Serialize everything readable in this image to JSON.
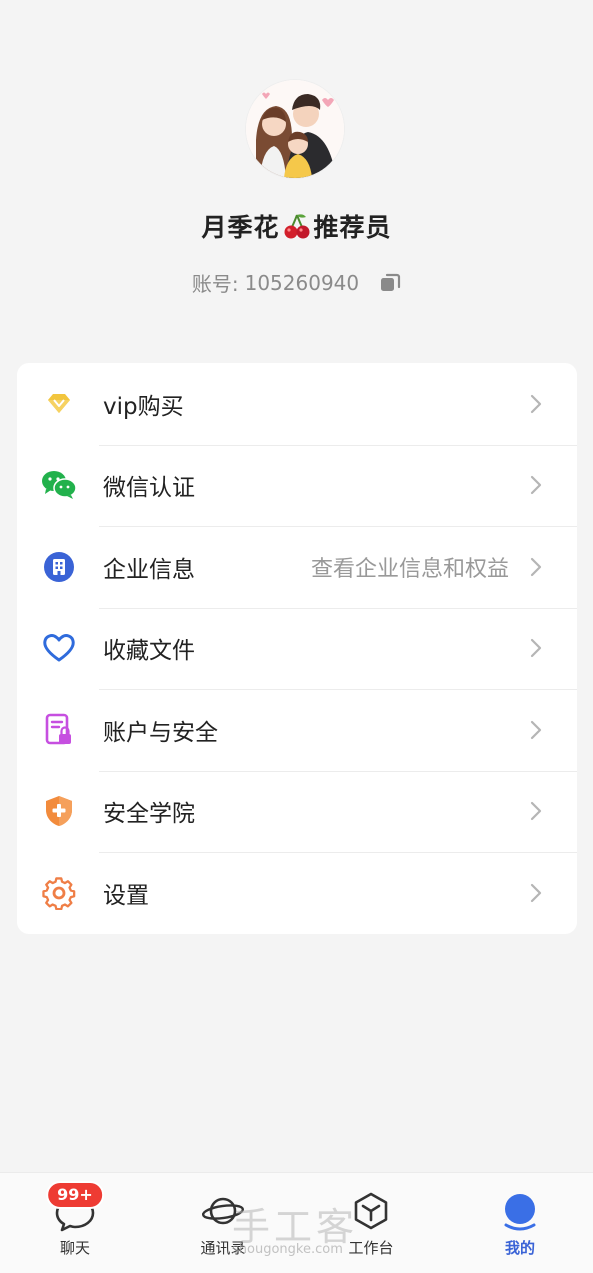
{
  "profile": {
    "name": "月季花",
    "name_suffix": "推荐员",
    "account_label": "账号:",
    "account_number": "105260940"
  },
  "menu": [
    {
      "label": "vip购买",
      "hint": "",
      "icon": "diamond-icon",
      "color": "#f2c53d"
    },
    {
      "label": "微信认证",
      "hint": "",
      "icon": "wechat-icon",
      "color": "#22b14c"
    },
    {
      "label": "企业信息",
      "hint": "查看企业信息和权益",
      "icon": "building-icon",
      "color": "#3a63d6"
    },
    {
      "label": "收藏文件",
      "hint": "",
      "icon": "heart-icon",
      "color": "#2f6bdc"
    },
    {
      "label": "账户与安全",
      "hint": "",
      "icon": "account-security-icon",
      "color": "#c64fe0"
    },
    {
      "label": "安全学院",
      "hint": "",
      "icon": "shield-icon",
      "color": "#f28b3c"
    },
    {
      "label": "设置",
      "hint": "",
      "icon": "gear-icon",
      "color": "#ef7e46"
    }
  ],
  "tabbar": {
    "tabs": [
      {
        "label": "聊天",
        "icon": "chat-icon",
        "badge": "99+"
      },
      {
        "label": "通讯录",
        "icon": "planet-icon"
      },
      {
        "label": "工作台",
        "icon": "cube-icon"
      },
      {
        "label": "我的",
        "icon": "profile-icon",
        "active": true
      }
    ]
  },
  "watermark": {
    "text": "手工客",
    "url": "shougongke.com"
  },
  "colors": {
    "accent": "#3a63d6",
    "badge": "#ee3b33",
    "background": "#f4f4f4"
  }
}
